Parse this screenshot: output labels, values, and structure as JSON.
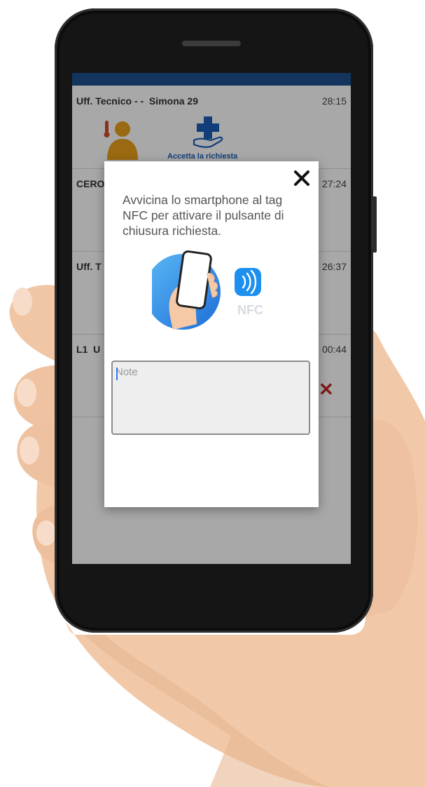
{
  "app": {
    "topbar_color": "#1e4f8e",
    "requests": [
      {
        "title": "Uff. Tecnico - -  Simona 29",
        "time": "28:15",
        "action_label": "Accetta la richiesta"
      },
      {
        "title": "CERO",
        "time": "27:24"
      },
      {
        "title": "Uff. T",
        "time": "26:37"
      },
      {
        "title": "L1  U",
        "time": "00:44"
      }
    ]
  },
  "modal": {
    "message": "Avvicina lo smartphone al tag NFC per attivare il pulsante di chiusura richiesta.",
    "nfc_label": "NFC",
    "note_placeholder": "Note",
    "note_value": "",
    "close_icon": "close-icon"
  },
  "colors": {
    "accent_blue": "#1a5fb8",
    "user_icon_orange": "#e8a21a",
    "cancel_red": "#c62828"
  }
}
